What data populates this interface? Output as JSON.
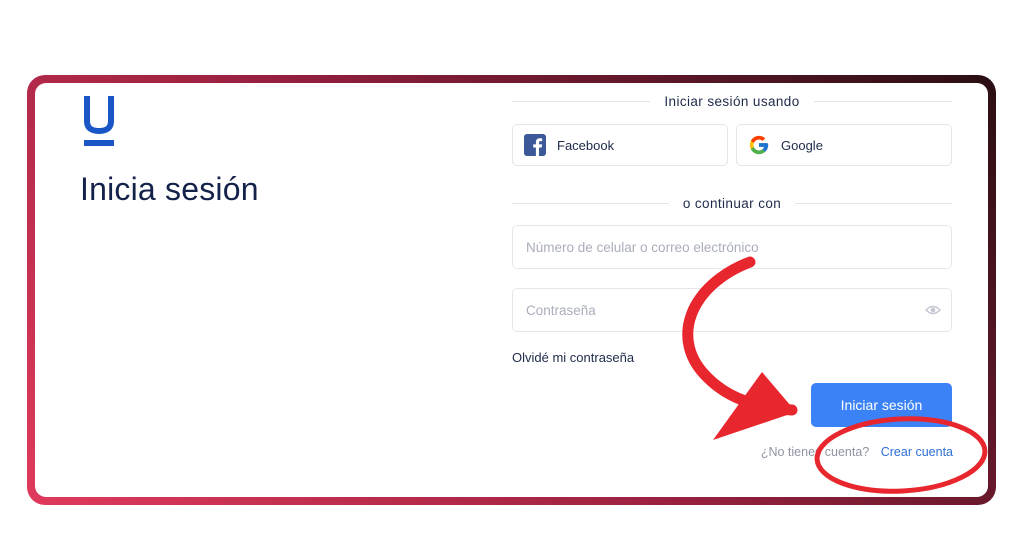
{
  "brand": {
    "logo_icon": "u-logo-icon",
    "color": "#1a56c6"
  },
  "page": {
    "title": "Inicia sesión"
  },
  "social_login": {
    "divider_label": "Iniciar sesión usando",
    "facebook_label": "Facebook",
    "google_label": "Google"
  },
  "form": {
    "divider_label": "o continuar con",
    "username_placeholder": "Número de celular o correo electrónico",
    "password_placeholder": "Contraseña",
    "forgot_password": "Olvidé mi contraseña",
    "submit_label": "Iniciar sesión",
    "no_account_prompt": "¿No tienes cuenta?",
    "create_account": "Crear cuenta"
  },
  "annotation": {
    "color": "#e8262d",
    "arrow_icon": "curved-arrow-icon",
    "highlight": "circle-highlight"
  },
  "colors": {
    "accent": "#3b82f6",
    "title_text": "#14224a",
    "link": "#2f6fd6"
  }
}
